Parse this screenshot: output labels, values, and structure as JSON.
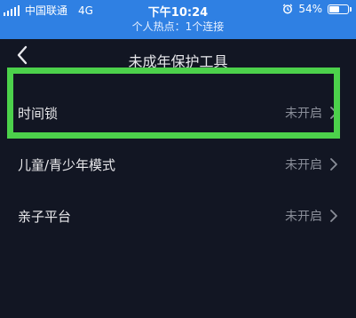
{
  "status_bar": {
    "carrier": "中国联通",
    "network": "4G",
    "time": "下午10:24",
    "battery": "54%",
    "battery_level": 0.54,
    "hotspot": "个人热点：1个连接"
  },
  "nav": {
    "title": "未成年保护工具",
    "back_icon": "chevron-left-icon"
  },
  "items": [
    {
      "label": "时间锁",
      "status": "未开启"
    },
    {
      "label": "儿童/青少年模式",
      "status": "未开启"
    },
    {
      "label": "亲子平台",
      "status": "未开启"
    }
  ],
  "colors": {
    "status_bar_bg": "#2f80e3",
    "page_bg": "#121623",
    "highlight": "#4cd14b",
    "status_text": "#8a8e99"
  }
}
